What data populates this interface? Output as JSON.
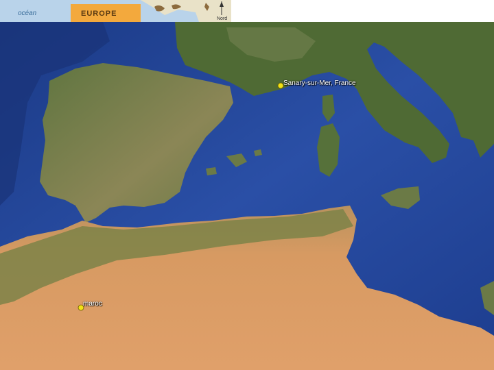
{
  "inset": {
    "ocean_label": "océan",
    "region_label": "EUROPE",
    "north_label": "Nord"
  },
  "markers": [
    {
      "label": "Sanary-sur-Mer, France",
      "color": "#f2e316"
    },
    {
      "label": "maroc",
      "color": "#f2e316"
    }
  ],
  "colors": {
    "deep_sea": "#1e3c8c",
    "shallow_sea": "#3a63b4",
    "forest_land": "#4e6a33",
    "dry_land": "#8a8a52",
    "desert": "#d49862"
  }
}
